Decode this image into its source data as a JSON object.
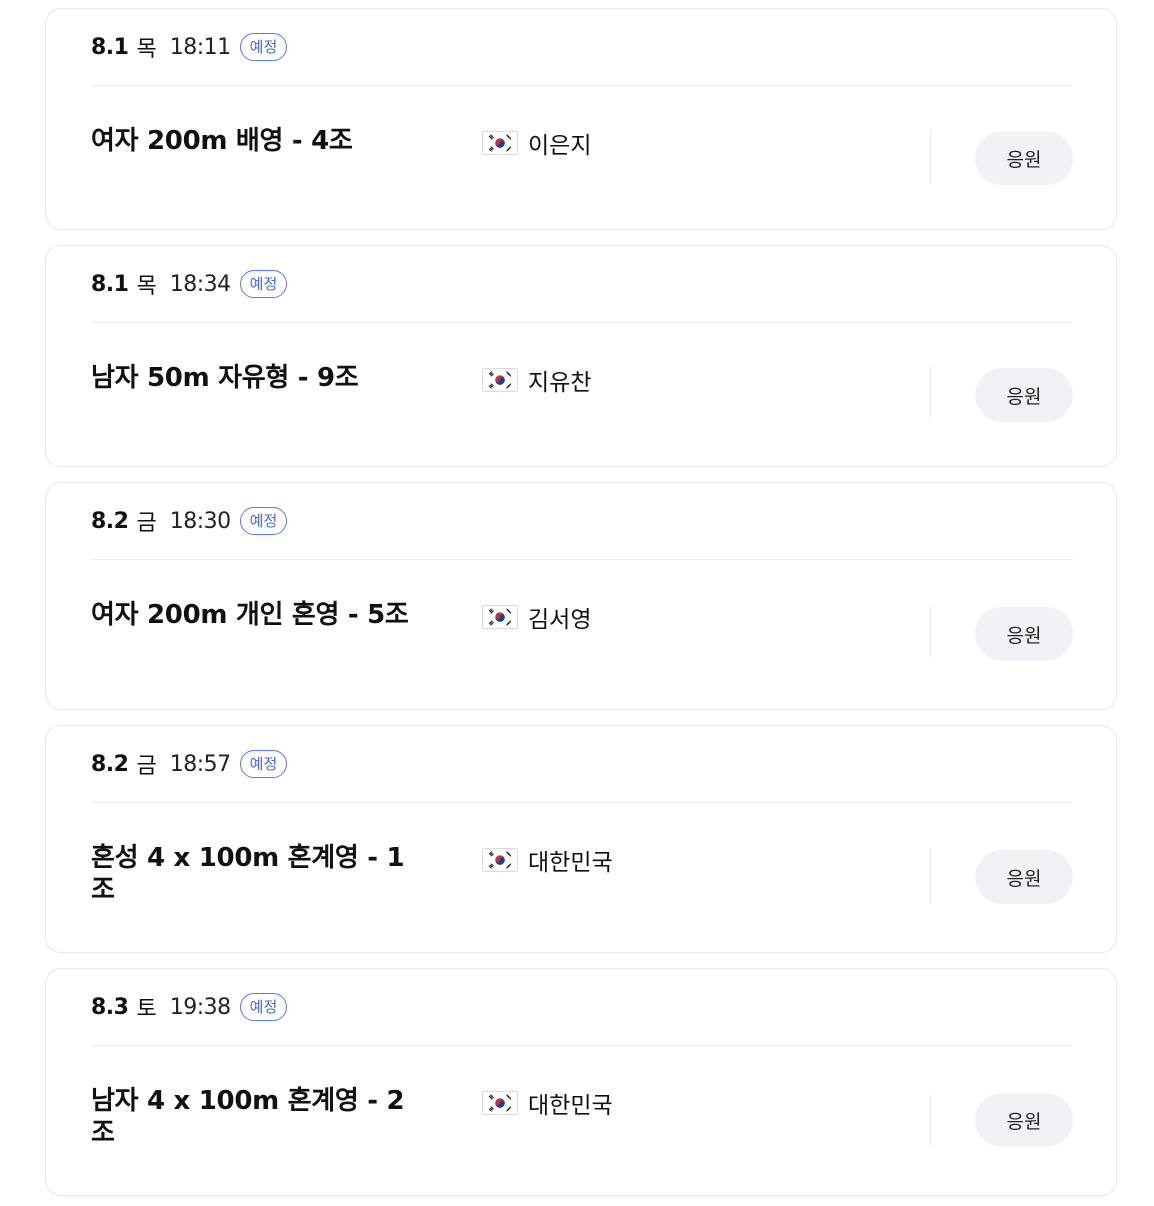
{
  "schedule": [
    {
      "date": "8.1",
      "weekday": "목",
      "time": "18:11",
      "status": "예정",
      "event": "여자 200m 배영 - 4조",
      "athlete": "이은지",
      "flag": "south-korea-flag-icon",
      "cheer_label": "응원"
    },
    {
      "date": "8.1",
      "weekday": "목",
      "time": "18:34",
      "status": "예정",
      "event": "남자 50m 자유형 - 9조",
      "athlete": "지유찬",
      "flag": "south-korea-flag-icon",
      "cheer_label": "응원"
    },
    {
      "date": "8.2",
      "weekday": "금",
      "time": "18:30",
      "status": "예정",
      "event": "여자 200m 개인 혼영 - 5조",
      "athlete": "김서영",
      "flag": "south-korea-flag-icon",
      "cheer_label": "응원"
    },
    {
      "date": "8.2",
      "weekday": "금",
      "time": "18:57",
      "status": "예정",
      "event": "혼성 4 x 100m 혼계영 - 1조",
      "athlete": "대한민국",
      "flag": "south-korea-flag-icon",
      "cheer_label": "응원"
    },
    {
      "date": "8.3",
      "weekday": "토",
      "time": "19:38",
      "status": "예정",
      "event": "남자 4 x 100m 혼계영 - 2조",
      "athlete": "대한민국",
      "flag": "south-korea-flag-icon",
      "cheer_label": "응원"
    }
  ],
  "colors": {
    "status_accent": "#4a6ae3",
    "button_bg": "#f1f2f6",
    "card_border": "#e6e8ec"
  }
}
